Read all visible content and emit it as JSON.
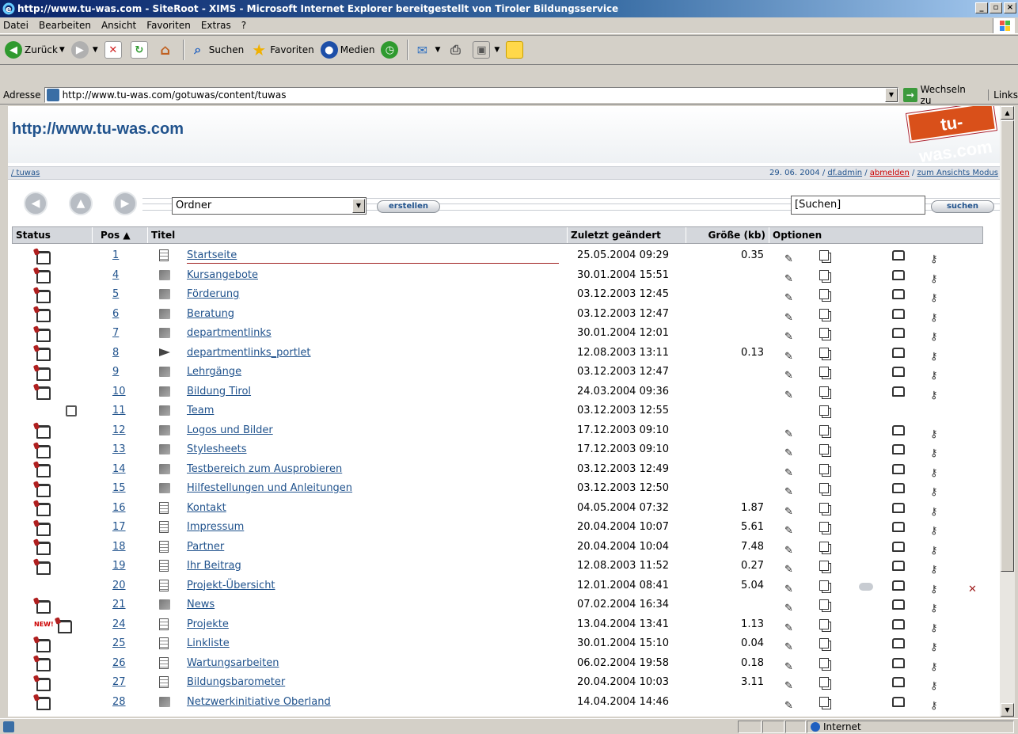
{
  "window": {
    "title": "http://www.tu-was.com - SiteRoot - XIMS - Microsoft Internet Explorer bereitgestellt von Tiroler Bildungsservice"
  },
  "menu": [
    "Datei",
    "Bearbeiten",
    "Ansicht",
    "Favoriten",
    "Extras",
    "?"
  ],
  "toolbar": {
    "back": "Zurück",
    "search": "Suchen",
    "favorites": "Favoriten",
    "media": "Medien"
  },
  "address": {
    "label": "Adresse",
    "url": "http://www.tu-was.com/gotuwas/content/tuwas",
    "go": "Wechseln zu",
    "links": "Links"
  },
  "page": {
    "site_url": "http://www.tu-was.com",
    "logo_text": "tu-was.com",
    "breadcrumb": "/ tuwas",
    "date": "29. 06. 2004",
    "user": "df.admin",
    "logout": "abmelden",
    "view_mode": "zum Ansichts Modus",
    "create_type": "Ordner",
    "create_button": "erstellen",
    "search_value": "[Suchen]",
    "search_button": "suchen"
  },
  "table": {
    "headers": {
      "status": "Status",
      "pos": "Pos ▲",
      "title": "Titel",
      "modified": "Zuletzt geändert",
      "size": "Größe (kb)",
      "options": "Optionen"
    },
    "rows": [
      {
        "status": "published",
        "pos": "1",
        "type": "doc",
        "title": "Startseite",
        "date": "25.05.2004 09:29",
        "size": "0.35",
        "opts": "full"
      },
      {
        "status": "published",
        "pos": "4",
        "type": "folder",
        "title": "Kursangebote",
        "date": "30.01.2004 15:51",
        "size": "",
        "opts": "full"
      },
      {
        "status": "published",
        "pos": "5",
        "type": "folder",
        "title": "Förderung",
        "date": "03.12.2003 12:45",
        "size": "",
        "opts": "full"
      },
      {
        "status": "published",
        "pos": "6",
        "type": "folder",
        "title": "Beratung",
        "date": "03.12.2003 12:47",
        "size": "",
        "opts": "full"
      },
      {
        "status": "published",
        "pos": "7",
        "type": "folder",
        "title": "departmentlinks",
        "date": "30.01.2004 12:01",
        "size": "",
        "opts": "full"
      },
      {
        "status": "published",
        "pos": "8",
        "type": "link",
        "title": "departmentlinks_portlet",
        "date": "12.08.2003 13:11",
        "size": "0.13",
        "opts": "full"
      },
      {
        "status": "published",
        "pos": "9",
        "type": "folder",
        "title": "Lehrgänge",
        "date": "03.12.2003 12:47",
        "size": "",
        "opts": "full"
      },
      {
        "status": "published",
        "pos": "10",
        "type": "folder",
        "title": "Bildung Tirol",
        "date": "24.03.2004 09:36",
        "size": "",
        "opts": "full"
      },
      {
        "status": "locked",
        "pos": "11",
        "type": "folder",
        "title": "Team",
        "date": "03.12.2003 12:55",
        "size": "",
        "opts": "copy"
      },
      {
        "status": "published",
        "pos": "12",
        "type": "folder",
        "title": "Logos und Bilder",
        "date": "17.12.2003 09:10",
        "size": "",
        "opts": "full"
      },
      {
        "status": "published",
        "pos": "13",
        "type": "folder",
        "title": "Stylesheets",
        "date": "17.12.2003 09:10",
        "size": "",
        "opts": "full"
      },
      {
        "status": "published",
        "pos": "14",
        "type": "folder",
        "title": "Testbereich zum Ausprobieren",
        "date": "03.12.2003 12:49",
        "size": "",
        "opts": "full"
      },
      {
        "status": "published",
        "pos": "15",
        "type": "folder",
        "title": "Hilfestellungen und Anleitungen",
        "date": "03.12.2003 12:50",
        "size": "",
        "opts": "full"
      },
      {
        "status": "published",
        "pos": "16",
        "type": "doc",
        "title": "Kontakt",
        "date": "04.05.2004 07:32",
        "size": "1.87",
        "opts": "full"
      },
      {
        "status": "published",
        "pos": "17",
        "type": "doc",
        "title": "Impressum",
        "date": "20.04.2004 10:07",
        "size": "5.61",
        "opts": "full"
      },
      {
        "status": "published",
        "pos": "18",
        "type": "doc",
        "title": "Partner",
        "date": "20.04.2004 10:04",
        "size": "7.48",
        "opts": "full"
      },
      {
        "status": "published",
        "pos": "19",
        "type": "doc",
        "title": "Ihr Beitrag",
        "date": "12.08.2003 11:52",
        "size": "0.27",
        "opts": "full"
      },
      {
        "status": "none",
        "pos": "20",
        "type": "doc",
        "title": "Projekt-Übersicht",
        "date": "12.01.2004 08:41",
        "size": "5.04",
        "opts": "all"
      },
      {
        "status": "published",
        "pos": "21",
        "type": "folder",
        "title": "News",
        "date": "07.02.2004 16:34",
        "size": "",
        "opts": "full"
      },
      {
        "status": "new",
        "pos": "24",
        "type": "doc",
        "title": "Projekte",
        "date": "13.04.2004 13:41",
        "size": "1.13",
        "opts": "full"
      },
      {
        "status": "published",
        "pos": "25",
        "type": "doc",
        "title": "Linkliste",
        "date": "30.01.2004 15:10",
        "size": "0.04",
        "opts": "full"
      },
      {
        "status": "published",
        "pos": "26",
        "type": "doc",
        "title": "Wartungsarbeiten",
        "date": "06.02.2004 19:58",
        "size": "0.18",
        "opts": "full"
      },
      {
        "status": "published",
        "pos": "27",
        "type": "doc",
        "title": "Bildungsbarometer",
        "date": "20.04.2004 10:03",
        "size": "3.11",
        "opts": "full"
      },
      {
        "status": "published",
        "pos": "28",
        "type": "folder",
        "title": "Netzwerkinitiative Oberland",
        "date": "14.04.2004 14:46",
        "size": "",
        "opts": "full"
      }
    ],
    "new_label": "NEW!"
  },
  "statusbar": {
    "zone": "Internet"
  }
}
